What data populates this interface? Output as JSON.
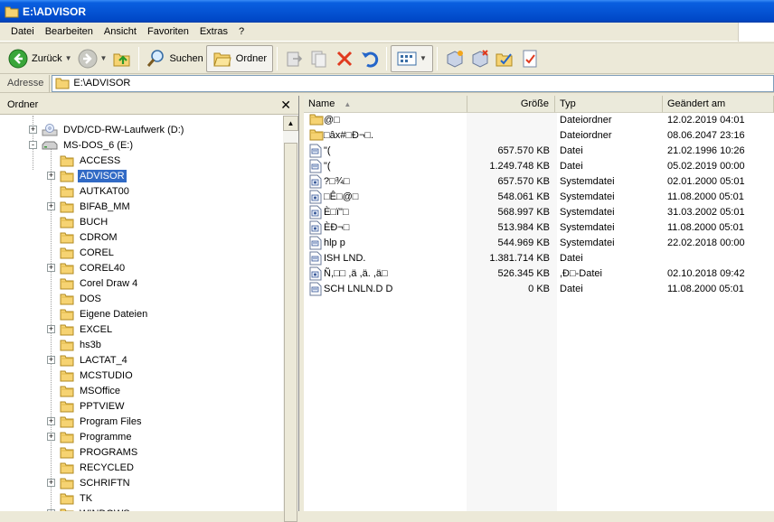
{
  "window": {
    "title": "E:\\ADVISOR"
  },
  "menu": [
    "Datei",
    "Bearbeiten",
    "Ansicht",
    "Favoriten",
    "Extras",
    "?"
  ],
  "toolbar": {
    "back_label": "Zurück",
    "search_label": "Suchen",
    "folders_label": "Ordner"
  },
  "address": {
    "label": "Adresse",
    "path": "E:\\ADVISOR"
  },
  "tree": {
    "title": "Ordner",
    "close_glyph": "✕",
    "items": [
      {
        "label": "DVD/CD-RW-Laufwerk (D:)",
        "level": 1,
        "expand": "+",
        "icon": "cd-drive-icon"
      },
      {
        "label": "MS-DOS_6 (E:)",
        "level": 1,
        "expand": "-",
        "icon": "hard-drive-icon"
      },
      {
        "label": "ACCESS",
        "level": 2,
        "expand": "",
        "icon": "folder-icon"
      },
      {
        "label": "ADVISOR",
        "level": 2,
        "expand": "+",
        "icon": "folder-icon",
        "selected": true
      },
      {
        "label": "AUTKAT00",
        "level": 2,
        "expand": "",
        "icon": "folder-icon"
      },
      {
        "label": "BIFAB_MM",
        "level": 2,
        "expand": "+",
        "icon": "folder-icon"
      },
      {
        "label": "BUCH",
        "level": 2,
        "expand": "",
        "icon": "folder-icon"
      },
      {
        "label": "CDROM",
        "level": 2,
        "expand": "",
        "icon": "folder-icon"
      },
      {
        "label": "COREL",
        "level": 2,
        "expand": "",
        "icon": "folder-icon"
      },
      {
        "label": "COREL40",
        "level": 2,
        "expand": "+",
        "icon": "folder-icon"
      },
      {
        "label": "Corel Draw 4",
        "level": 2,
        "expand": "",
        "icon": "folder-icon"
      },
      {
        "label": "DOS",
        "level": 2,
        "expand": "",
        "icon": "folder-icon"
      },
      {
        "label": "Eigene Dateien",
        "level": 2,
        "expand": "",
        "icon": "folder-icon"
      },
      {
        "label": "EXCEL",
        "level": 2,
        "expand": "+",
        "icon": "folder-icon"
      },
      {
        "label": "hs3b",
        "level": 2,
        "expand": "",
        "icon": "folder-icon"
      },
      {
        "label": "LACTAT_4",
        "level": 2,
        "expand": "+",
        "icon": "folder-icon"
      },
      {
        "label": "MCSTUDIO",
        "level": 2,
        "expand": "",
        "icon": "folder-icon"
      },
      {
        "label": "MSOffice",
        "level": 2,
        "expand": "",
        "icon": "folder-icon"
      },
      {
        "label": "PPTVIEW",
        "level": 2,
        "expand": "",
        "icon": "folder-icon"
      },
      {
        "label": "Program Files",
        "level": 2,
        "expand": "+",
        "icon": "folder-icon"
      },
      {
        "label": "Programme",
        "level": 2,
        "expand": "+",
        "icon": "folder-icon"
      },
      {
        "label": "PROGRAMS",
        "level": 2,
        "expand": "",
        "icon": "folder-icon"
      },
      {
        "label": "RECYCLED",
        "level": 2,
        "expand": "",
        "icon": "folder-icon"
      },
      {
        "label": "SCHRIFTN",
        "level": 2,
        "expand": "+",
        "icon": "folder-icon"
      },
      {
        "label": "TK",
        "level": 2,
        "expand": "",
        "icon": "folder-icon"
      },
      {
        "label": "WINDOWS",
        "level": 2,
        "expand": "+",
        "icon": "folder-icon"
      }
    ]
  },
  "list": {
    "columns": {
      "name": "Name",
      "size": "Größe",
      "type": "Typ",
      "modified": "Geändert am"
    },
    "rows": [
      {
        "name": "@□",
        "size": "",
        "type": "Dateiordner",
        "modified": "12.02.2019 04:01",
        "icon": "folder-icon"
      },
      {
        "name": "□âx#□Ð¬□.",
        "size": "",
        "type": "Dateiordner",
        "modified": "08.06.2047 23:16",
        "icon": "folder-icon"
      },
      {
        "name": "\"(",
        "size": "657.570 KB",
        "type": "Datei",
        "modified": "21.02.1996 10:26",
        "icon": "generic-file-icon"
      },
      {
        "name": "\"(",
        "size": "1.249.748 KB",
        "type": "Datei",
        "modified": "05.02.2019 00:00",
        "icon": "generic-file-icon"
      },
      {
        "name": "?□¾□",
        "size": "657.570 KB",
        "type": "Systemdatei",
        "modified": "02.01.2000 05:01",
        "icon": "system-file-icon"
      },
      {
        "name": "□Ê□@□",
        "size": "548.061 KB",
        "type": "Systemdatei",
        "modified": "11.08.2000 05:01",
        "icon": "system-file-icon"
      },
      {
        "name": "È□ï\"□",
        "size": "568.997 KB",
        "type": "Systemdatei",
        "modified": "31.03.2002 05:01",
        "icon": "system-file-icon"
      },
      {
        "name": "ÈÐ¬□",
        "size": "513.984 KB",
        "type": "Systemdatei",
        "modified": "11.08.2000 05:01",
        "icon": "system-file-icon"
      },
      {
        "name": "hlp p",
        "size": "544.969 KB",
        "type": "Systemdatei",
        "modified": "22.02.2018 00:00",
        "icon": "generic-file-icon"
      },
      {
        "name": "ISH LND.",
        "size": "1.381.714 KB",
        "type": "Datei",
        "modified": "",
        "icon": "generic-file-icon"
      },
      {
        "name": "Ñ,□□ ,ä ,ä. ,ä□",
        "size": "526.345 KB",
        "type": ",Ð□-Datei",
        "modified": "02.10.2018 09:42",
        "icon": "system-file-icon"
      },
      {
        "name": "SCH LNLN.D D",
        "size": "0 KB",
        "type": "Datei",
        "modified": "11.08.2000 05:01",
        "icon": "generic-file-icon"
      }
    ]
  },
  "colors": {
    "titlebar": "#0554d4",
    "selection": "#316ac5",
    "chrome": "#ece9d8"
  }
}
